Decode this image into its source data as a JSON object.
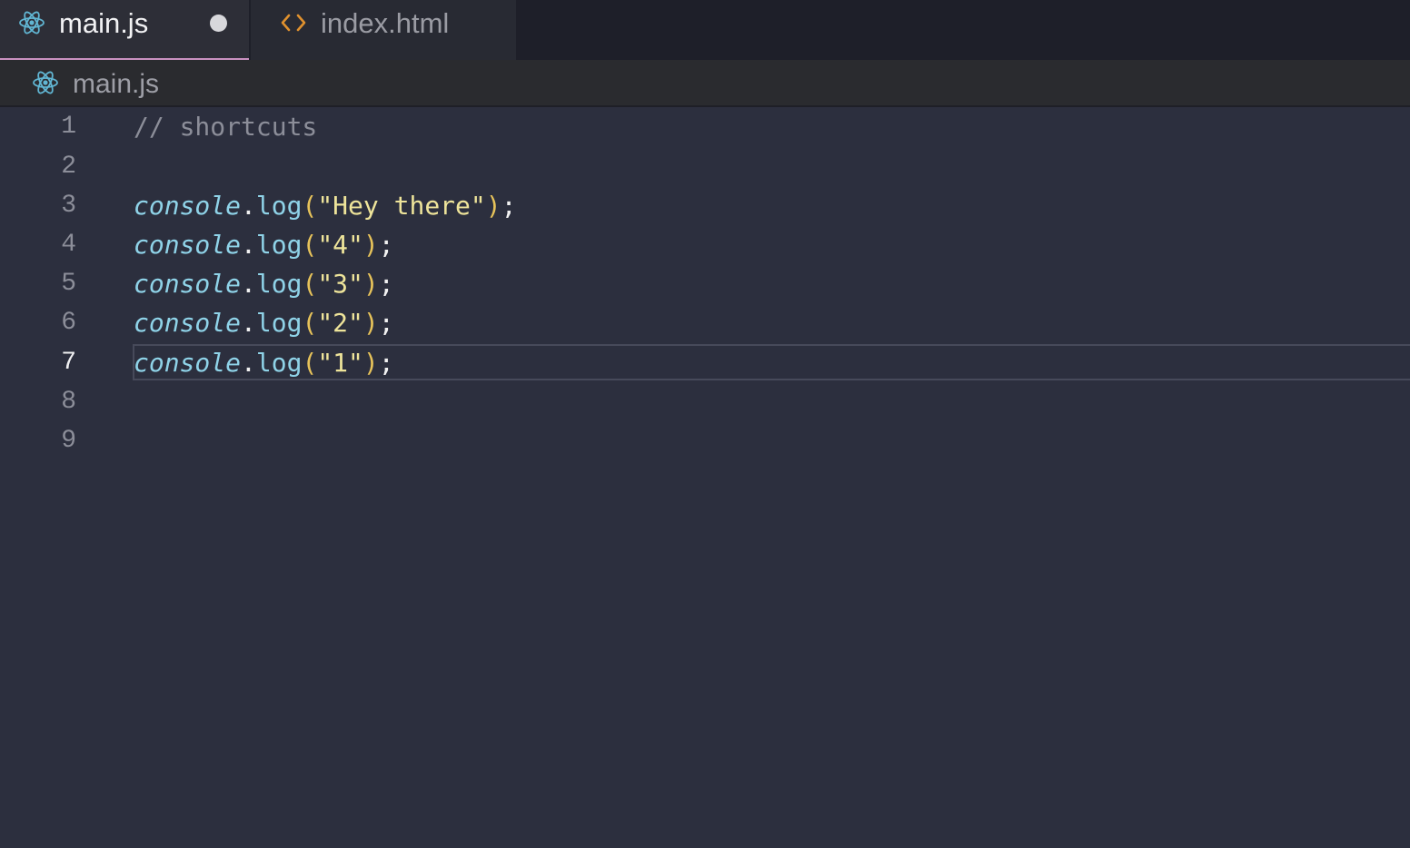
{
  "tabs": [
    {
      "label": "main.js",
      "icon": "react-icon",
      "active": true,
      "unsaved": true
    },
    {
      "label": "index.html",
      "icon": "code-brackets-icon",
      "active": false,
      "unsaved": false
    }
  ],
  "breadcrumb": {
    "label": "main.js",
    "icon": "react-icon"
  },
  "editor": {
    "active_line": 7,
    "lines": [
      {
        "number": "1",
        "tokens": [
          {
            "type": "comment",
            "text": "// shortcuts"
          }
        ]
      },
      {
        "number": "2",
        "tokens": []
      },
      {
        "number": "3",
        "tokens": [
          {
            "type": "object",
            "text": "console"
          },
          {
            "type": "punct",
            "text": "."
          },
          {
            "type": "method",
            "text": "log"
          },
          {
            "type": "paren",
            "text": "("
          },
          {
            "type": "string",
            "text": "\"Hey there\""
          },
          {
            "type": "paren",
            "text": ")"
          },
          {
            "type": "punct",
            "text": ";"
          }
        ]
      },
      {
        "number": "4",
        "tokens": [
          {
            "type": "object",
            "text": "console"
          },
          {
            "type": "punct",
            "text": "."
          },
          {
            "type": "method",
            "text": "log"
          },
          {
            "type": "paren",
            "text": "("
          },
          {
            "type": "string",
            "text": "\"4\""
          },
          {
            "type": "paren",
            "text": ")"
          },
          {
            "type": "punct",
            "text": ";"
          }
        ]
      },
      {
        "number": "5",
        "tokens": [
          {
            "type": "object",
            "text": "console"
          },
          {
            "type": "punct",
            "text": "."
          },
          {
            "type": "method",
            "text": "log"
          },
          {
            "type": "paren",
            "text": "("
          },
          {
            "type": "string",
            "text": "\"3\""
          },
          {
            "type": "paren",
            "text": ")"
          },
          {
            "type": "punct",
            "text": ";"
          }
        ]
      },
      {
        "number": "6",
        "tokens": [
          {
            "type": "object",
            "text": "console"
          },
          {
            "type": "punct",
            "text": "."
          },
          {
            "type": "method",
            "text": "log"
          },
          {
            "type": "paren",
            "text": "("
          },
          {
            "type": "string",
            "text": "\"2\""
          },
          {
            "type": "paren",
            "text": ")"
          },
          {
            "type": "punct",
            "text": ";"
          }
        ]
      },
      {
        "number": "7",
        "tokens": [
          {
            "type": "object",
            "text": "console"
          },
          {
            "type": "punct",
            "text": "."
          },
          {
            "type": "method",
            "text": "log"
          },
          {
            "type": "paren",
            "text": "("
          },
          {
            "type": "string",
            "text": "\"1\""
          },
          {
            "type": "paren",
            "text": ")"
          },
          {
            "type": "punct",
            "text": ";"
          }
        ]
      },
      {
        "number": "8",
        "tokens": []
      },
      {
        "number": "9",
        "tokens": []
      }
    ]
  },
  "colors": {
    "editor_background": "#2c2f3e",
    "tab_bar_background": "#1e1f29",
    "active_tab_indicator": "#c991c0",
    "react_icon": "#61b6d3",
    "html_icon": "#e0912e",
    "comment": "#8c8e99",
    "keyword_object": "#8fd3e8",
    "string": "#eee49a",
    "paren": "#e7c35a"
  }
}
